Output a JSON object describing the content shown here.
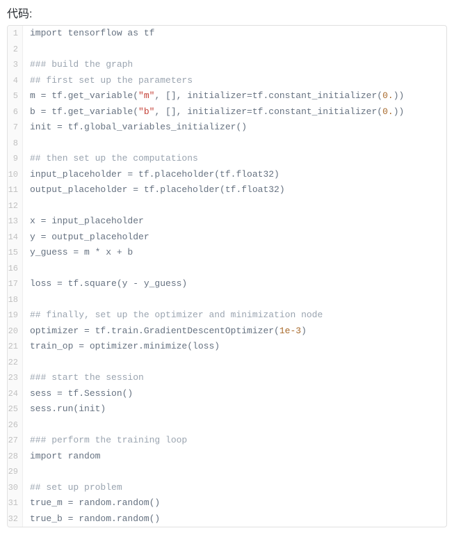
{
  "title": "代码:",
  "code": {
    "lines": [
      {
        "n": 1,
        "tokens": [
          {
            "t": "import tensorflow as tf",
            "c": "default"
          }
        ]
      },
      {
        "n": 2,
        "tokens": [
          {
            "t": "",
            "c": "default"
          }
        ]
      },
      {
        "n": 3,
        "tokens": [
          {
            "t": "### build the graph",
            "c": "comment"
          }
        ]
      },
      {
        "n": 4,
        "tokens": [
          {
            "t": "## first set up the parameters",
            "c": "comment"
          }
        ]
      },
      {
        "n": 5,
        "tokens": [
          {
            "t": "m = tf.get_variable(",
            "c": "default"
          },
          {
            "t": "\"m\"",
            "c": "string"
          },
          {
            "t": ", [], initializer=tf.constant_initializer(",
            "c": "default"
          },
          {
            "t": "0.",
            "c": "number"
          },
          {
            "t": "))",
            "c": "default"
          }
        ]
      },
      {
        "n": 6,
        "tokens": [
          {
            "t": "b = tf.get_variable(",
            "c": "default"
          },
          {
            "t": "\"b\"",
            "c": "string"
          },
          {
            "t": ", [], initializer=tf.constant_initializer(",
            "c": "default"
          },
          {
            "t": "0.",
            "c": "number"
          },
          {
            "t": "))",
            "c": "default"
          }
        ]
      },
      {
        "n": 7,
        "tokens": [
          {
            "t": "init = tf.global_variables_initializer()",
            "c": "default"
          }
        ]
      },
      {
        "n": 8,
        "tokens": [
          {
            "t": "",
            "c": "default"
          }
        ]
      },
      {
        "n": 9,
        "tokens": [
          {
            "t": "## then set up the computations",
            "c": "comment"
          }
        ]
      },
      {
        "n": 10,
        "tokens": [
          {
            "t": "input_placeholder = tf.placeholder(tf.float32)",
            "c": "default"
          }
        ]
      },
      {
        "n": 11,
        "tokens": [
          {
            "t": "output_placeholder = tf.placeholder(tf.float32)",
            "c": "default"
          }
        ]
      },
      {
        "n": 12,
        "tokens": [
          {
            "t": "",
            "c": "default"
          }
        ]
      },
      {
        "n": 13,
        "tokens": [
          {
            "t": "x = input_placeholder",
            "c": "default"
          }
        ]
      },
      {
        "n": 14,
        "tokens": [
          {
            "t": "y = output_placeholder",
            "c": "default"
          }
        ]
      },
      {
        "n": 15,
        "tokens": [
          {
            "t": "y_guess = m * x + b",
            "c": "default"
          }
        ]
      },
      {
        "n": 16,
        "tokens": [
          {
            "t": "",
            "c": "default"
          }
        ]
      },
      {
        "n": 17,
        "tokens": [
          {
            "t": "loss = tf.square(y - y_guess)",
            "c": "default"
          }
        ]
      },
      {
        "n": 18,
        "tokens": [
          {
            "t": "",
            "c": "default"
          }
        ]
      },
      {
        "n": 19,
        "tokens": [
          {
            "t": "## finally, set up the optimizer and minimization node",
            "c": "comment"
          }
        ]
      },
      {
        "n": 20,
        "tokens": [
          {
            "t": "optimizer = tf.train.GradientDescentOptimizer(",
            "c": "default"
          },
          {
            "t": "1e-3",
            "c": "number"
          },
          {
            "t": ")",
            "c": "default"
          }
        ]
      },
      {
        "n": 21,
        "tokens": [
          {
            "t": "train_op = optimizer.minimize(loss)",
            "c": "default"
          }
        ]
      },
      {
        "n": 22,
        "tokens": [
          {
            "t": "",
            "c": "default"
          }
        ]
      },
      {
        "n": 23,
        "tokens": [
          {
            "t": "### start the session",
            "c": "comment"
          }
        ]
      },
      {
        "n": 24,
        "tokens": [
          {
            "t": "sess = tf.Session()",
            "c": "default"
          }
        ]
      },
      {
        "n": 25,
        "tokens": [
          {
            "t": "sess.run(init)",
            "c": "default"
          }
        ]
      },
      {
        "n": 26,
        "tokens": [
          {
            "t": "",
            "c": "default"
          }
        ]
      },
      {
        "n": 27,
        "tokens": [
          {
            "t": "### perform the training loop",
            "c": "comment"
          }
        ]
      },
      {
        "n": 28,
        "tokens": [
          {
            "t": "import random",
            "c": "default"
          }
        ]
      },
      {
        "n": 29,
        "tokens": [
          {
            "t": "",
            "c": "default"
          }
        ]
      },
      {
        "n": 30,
        "tokens": [
          {
            "t": "## set up problem",
            "c": "comment"
          }
        ]
      },
      {
        "n": 31,
        "tokens": [
          {
            "t": "true_m = random.random()",
            "c": "default"
          }
        ]
      },
      {
        "n": 32,
        "tokens": [
          {
            "t": "true_b = random.random()",
            "c": "default"
          }
        ]
      }
    ]
  }
}
